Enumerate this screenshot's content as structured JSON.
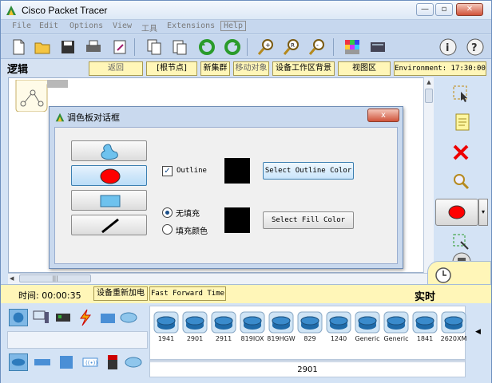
{
  "window": {
    "title": "Cisco Packet Tracer",
    "controls": [
      "minimize",
      "restore",
      "close"
    ]
  },
  "menu": [
    "File",
    "Edit",
    "Options",
    "View",
    "工具",
    "Extensions",
    "Help"
  ],
  "toolbar": {
    "icons": [
      "new-icon",
      "open-icon",
      "save-icon",
      "print-icon",
      "activity-wizard-icon",
      "copy-icon",
      "paste-icon",
      "undo-icon",
      "redo-icon",
      "zoom-in-icon",
      "zoom-reset-icon",
      "zoom-out-icon",
      "palette-icon",
      "custom-device-icon",
      "info-icon",
      "help-icon"
    ]
  },
  "nav": {
    "logic_label": "逻辑",
    "back": "返回",
    "root": "[根节点]",
    "new_cluster": "新集群",
    "move_object": "移动对象",
    "set_background": "设备工作区背景",
    "viewport": "视图区",
    "environment": "Environment: 17:30:00"
  },
  "dialog": {
    "title": "调色板对话框",
    "outline_label": "Outline",
    "outline_checked": true,
    "outline_button": "Select Outline Color",
    "no_fill": "无填充",
    "fill_color": "填充颜色",
    "fill_selected": "no_fill",
    "fill_button": "Select Fill Color",
    "outline_color": "#000000",
    "fill_swatch_color": "#000000",
    "shapes": [
      "freeform",
      "ellipse",
      "rectangle",
      "line"
    ],
    "selected_shape": "ellipse",
    "close_label": "x"
  },
  "right_tools": [
    "select-icon",
    "note-icon",
    "delete-icon",
    "inspect-icon",
    "shape-icon",
    "resize-icon",
    "pdu-icon"
  ],
  "timebar": {
    "time_label": "时间: 00:00:35",
    "power_cycle": "设备重新加电",
    "fast_forward": "Fast Forward Time",
    "realtime": "实时"
  },
  "devices": {
    "items": [
      "1941",
      "2901",
      "2911",
      "819IOX",
      "819HGW",
      "829",
      "1240",
      "Generic",
      "Generic",
      "1841",
      "2620XM"
    ],
    "selected_name": "2901"
  },
  "colors": {
    "accent": "#1c6fd1",
    "red_shape": "#ff0000",
    "shape_blue": "#6ec2ee",
    "nav_yellow": "#fff6b8"
  }
}
